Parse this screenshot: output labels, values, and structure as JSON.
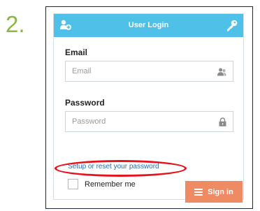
{
  "step_number": "2.",
  "header": {
    "title": "User Login",
    "left_icon": "add-user-icon",
    "right_icon": "key-icon",
    "color": "#4fc1e9"
  },
  "email": {
    "label": "Email",
    "placeholder": "Email",
    "icon": "user-icon"
  },
  "password": {
    "label": "Password",
    "placeholder": "Password",
    "icon": "lock-icon"
  },
  "reset_link": "Setup or reset your password",
  "remember_me": {
    "label": "Remember me",
    "checked": false
  },
  "sign_in": {
    "label": "Sign in",
    "icon": "menu-icon",
    "color": "#ee8b63"
  },
  "highlight_color": "#e8101a"
}
